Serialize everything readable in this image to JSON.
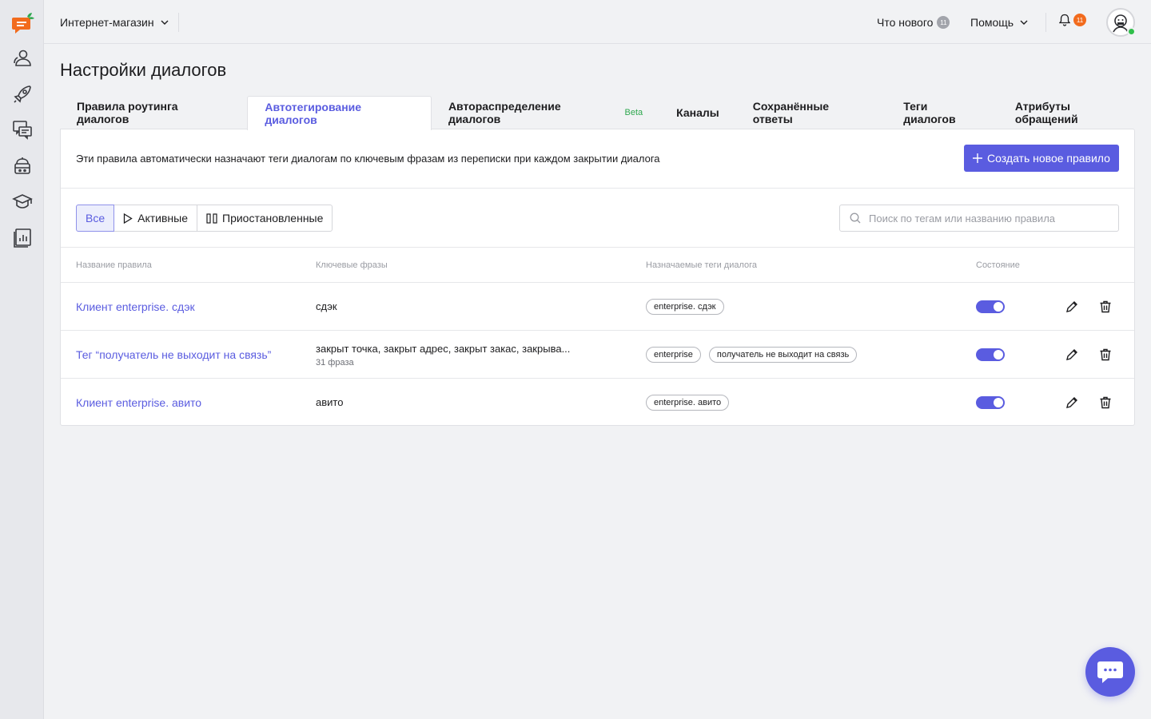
{
  "header": {
    "project": "Интернет-магазин",
    "whats_new": "Что нового",
    "whats_new_count": "11",
    "help": "Помощь",
    "notifications_count": "11"
  },
  "page": {
    "title": "Настройки диалогов"
  },
  "tabs": [
    {
      "label": "Правила роутинга диалогов"
    },
    {
      "label": "Автотегирование диалогов",
      "active": true
    },
    {
      "label": "Автораспределение диалогов",
      "badge": "Beta"
    },
    {
      "label": "Каналы"
    },
    {
      "label": "Сохранённые ответы"
    },
    {
      "label": "Теги диалогов"
    },
    {
      "label": "Атрибуты обращений"
    }
  ],
  "card": {
    "description": "Эти правила автоматически назначают теги диалогам по ключевым фразам из переписки при каждом закрытии диалога",
    "create_button": "Создать новое правило"
  },
  "filters": {
    "all": "Все",
    "active": "Активные",
    "paused": "Приостановленные",
    "search_placeholder": "Поиск по тегам или названию правила"
  },
  "table": {
    "columns": {
      "name": "Название правила",
      "phrases": "Ключевые фразы",
      "tags": "Назначаемые теги диалога",
      "state": "Состояние"
    },
    "rows": [
      {
        "name": "Клиент enterprise. сдэк",
        "phrases": "сдэк",
        "count": "",
        "tags": [
          "enterprise. сдэк"
        ],
        "enabled": true
      },
      {
        "name": "Тег “получатель не выходит на связь”",
        "phrases": "закрыт точка, закрыт адрес, закрыт закас, закрыва...",
        "count": "31 фраза",
        "tags": [
          "enterprise",
          "получатель не выходит на связь"
        ],
        "enabled": true
      },
      {
        "name": "Клиент enterprise. авито",
        "phrases": "авито",
        "count": "",
        "tags": [
          "enterprise. авито"
        ],
        "enabled": true
      }
    ]
  },
  "colors": {
    "accent": "#5a5ce0",
    "beta": "#2fa84f",
    "notification": "#f26b1d",
    "logo": "#f26b1d",
    "online": "#2fbf4a"
  },
  "icons": {
    "logo": "carrot-chat-logo-icon",
    "sidebar": [
      "users-icon",
      "rocket-icon",
      "chats-icon",
      "bot-icon",
      "graduation-cap-icon",
      "reports-icon"
    ],
    "chat_fab": "chat-bubble-icon"
  }
}
